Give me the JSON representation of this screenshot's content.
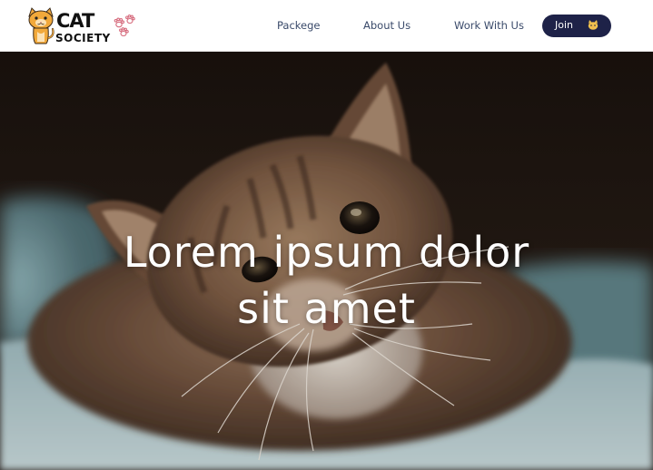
{
  "brand": {
    "logo_word_1": "CAT",
    "logo_word_2": "SOCIETY",
    "colors": {
      "cat_orange": "#f2a93b",
      "paw_pink": "#d66b7d",
      "ink": "#111111"
    },
    "icons": [
      "cat-mascot-icon",
      "paw-prints-icon"
    ]
  },
  "nav": {
    "links": [
      {
        "label": "Packege"
      },
      {
        "label": "About Us"
      },
      {
        "label": "Work With Us"
      }
    ],
    "join_label": "Join",
    "join_icon": "cat-face-icon",
    "link_color": "#3a4a6a",
    "join_bg": "#1e2248"
  },
  "hero": {
    "title_line_1": "Lorem ipsum dolor",
    "title_line_2": "sit amet",
    "image_subject": "kitten-photo"
  }
}
